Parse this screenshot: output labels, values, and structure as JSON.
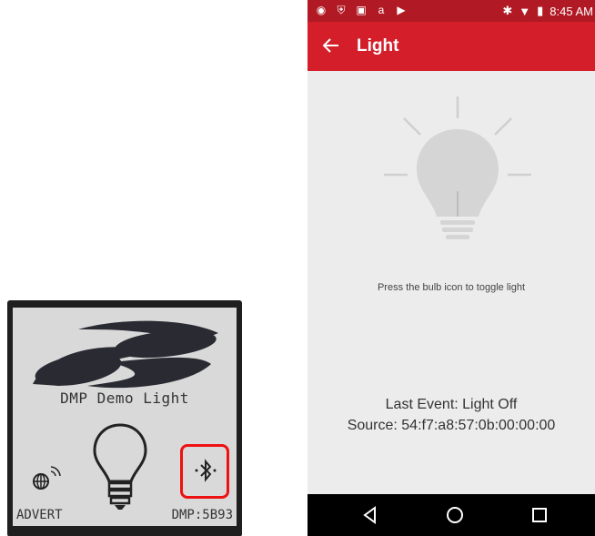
{
  "lcd": {
    "title": "DMP Demo Light",
    "status_left": "ADVERT",
    "status_right": "DMP:5B93",
    "icons": [
      "silabs-logo-icon",
      "lightbulb-icon",
      "wireless-globe-icon",
      "bluetooth-icon"
    ],
    "highlight_color": "#ee1111"
  },
  "phone": {
    "status_bar": {
      "time": "8:45 AM",
      "icons_left": [
        "chrome-icon",
        "shield-icon",
        "image-icon",
        "amazon-icon",
        "play-icon"
      ],
      "icons_right": [
        "bluetooth-icon",
        "wifi-icon",
        "battery-icon"
      ]
    },
    "app_bar": {
      "title": "Light",
      "color": "#d41f2b"
    },
    "bulb_state": "off",
    "hint": "Press the bulb icon to toggle light",
    "last_event": "Last Event: Light Off",
    "source": "Source: 54:f7:a8:57:0b:00:00:00",
    "nav": [
      "back-icon",
      "home-icon",
      "recents-icon"
    ]
  }
}
